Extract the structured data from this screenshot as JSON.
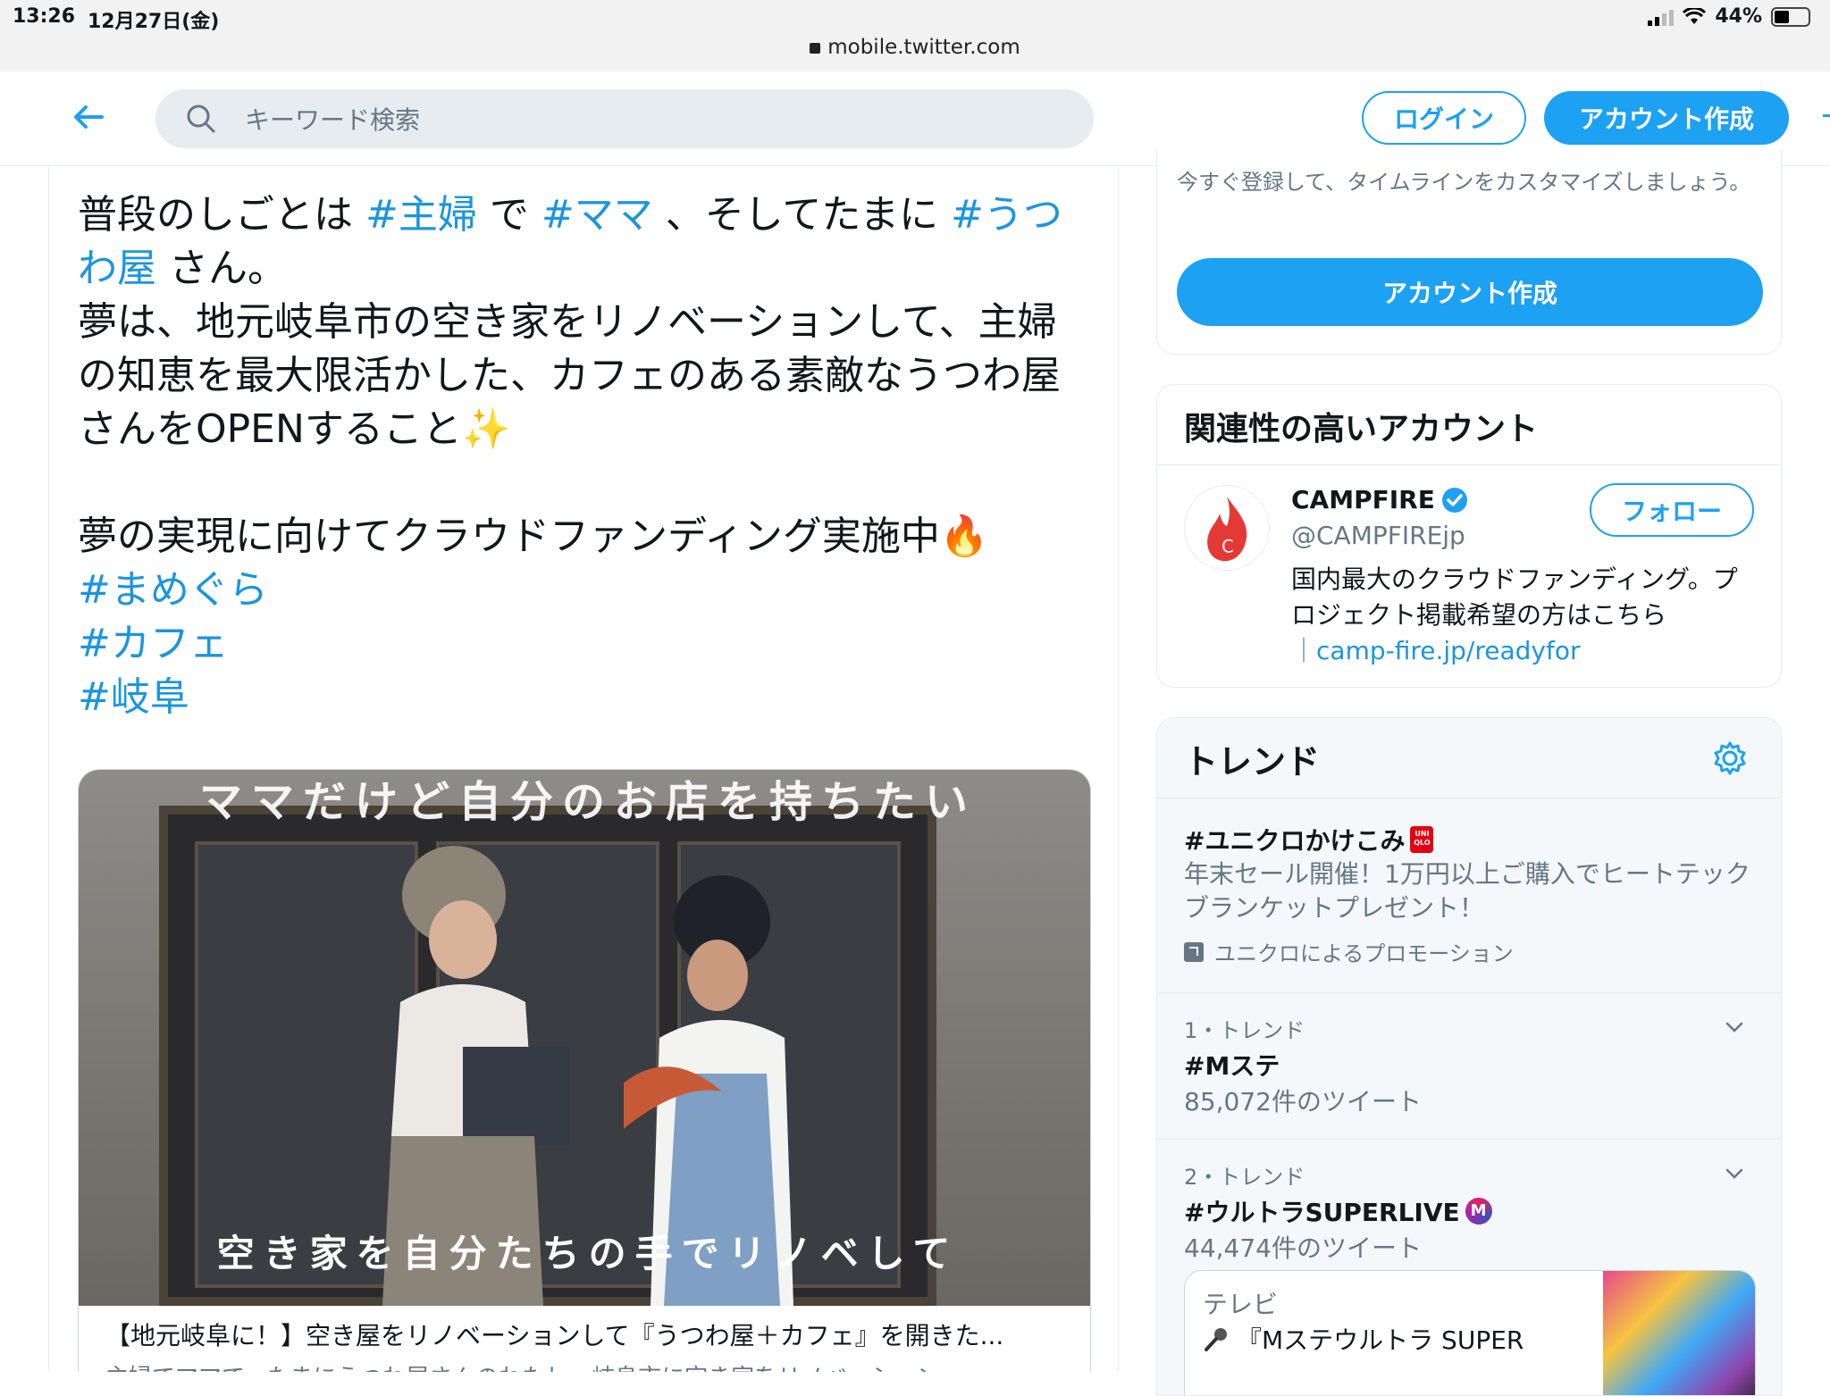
{
  "status_bar": {
    "time": "13:26",
    "date": "12月27日(金)",
    "battery": "44%",
    "url": "mobile.twitter.com"
  },
  "header": {
    "search_placeholder": "キーワード検索",
    "login_label": "ログイン",
    "signup_label": "アカウント作成"
  },
  "tweet": {
    "line1_a": "普段のしごとは ",
    "tag1": "#主婦",
    "line1_b": " で ",
    "tag2": "#ママ",
    "line1_c": " 、そしてたまに ",
    "tag3": "#うつわ屋",
    "line1_d": " さん。",
    "para2": "夢は、地元岐阜市の空き家をリノベーションして、主婦の知恵を最大限活かした、カフェのある素敵なうつわ屋さんをOPENすること",
    "para3": "夢の実現に向けてクラウドファンディング実施中",
    "tag4": "#まめぐら",
    "tag5": "#カフェ",
    "tag6": "#岐阜",
    "card": {
      "image_text_top": "ママだけど自分のお店を持ちたい",
      "image_text_bottom": "空き家を自分たちの手でリノベして",
      "title": "【地元岐阜に！】空き屋をリノベーションして『うつわ屋＋カフェ』を開きた...",
      "description": "主婦でママで、たまにうつわ屋さんのわたし。岐阜市に空き家をリノベーション"
    }
  },
  "signup_panel": {
    "text": "今すぐ登録して、タイムラインをカスタマイズしましょう。",
    "button": "アカウント作成"
  },
  "related": {
    "title": "関連性の高いアカウント",
    "account": {
      "name": "CAMPFIRE",
      "handle": "@CAMPFIREjp",
      "bio": "国内最大のクラウドファンディング。プロジェクト掲載希望の方はこちら",
      "bio_link": "camp-fire.jp/readyfor",
      "follow_label": "フォロー"
    }
  },
  "trends": {
    "title": "トレンド",
    "promoted": {
      "name": "#ユニクロかけこみ",
      "description": "年末セール開催！1万円以上ご購入でヒートテックブランケットプレゼント！",
      "promo_label": "ユニクロによるプロモーション"
    },
    "items": [
      {
        "meta": "1・トレンド",
        "name": "#Mステ",
        "count": "85,072件のツイート"
      },
      {
        "meta": "2・トレンド",
        "name": "#ウルトラSUPERLIVE",
        "count": "44,474件のツイート"
      }
    ],
    "tv_card": {
      "label": "テレビ",
      "title": "『Mステウルトラ SUPER"
    }
  },
  "colors": {
    "accent": "#1da1f2",
    "hashtag": "#1b95e0",
    "muted": "#657786"
  }
}
